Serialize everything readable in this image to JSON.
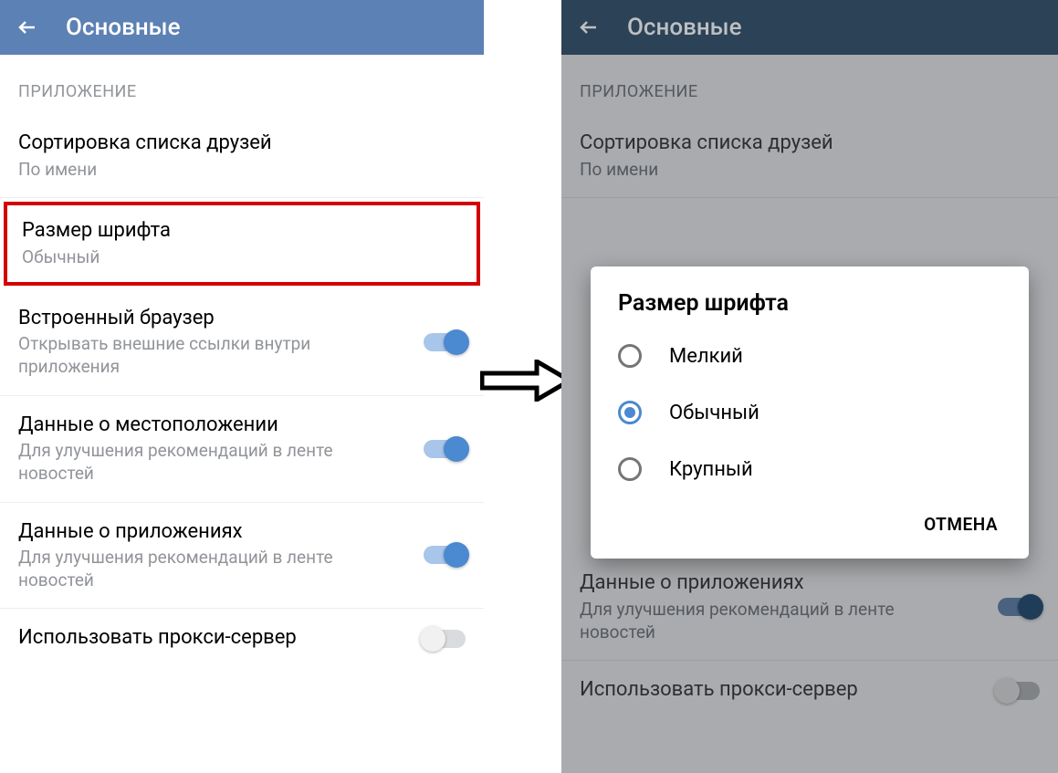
{
  "header": {
    "title": "Основные"
  },
  "section": "ПРИЛОЖЕНИЕ",
  "items": {
    "sort": {
      "title": "Сортировка списка друзей",
      "sub": "По имени"
    },
    "font": {
      "title": "Размер шрифта",
      "sub": "Обычный"
    },
    "browser": {
      "title": "Встроенный браузер",
      "sub": "Открывать внешние ссылки внутри приложения"
    },
    "location": {
      "title": "Данные о местоположении",
      "sub": "Для улучшения рекомендаций в ленте новостей"
    },
    "apps": {
      "title": "Данные о приложениях",
      "sub": "Для улучшения рекомендаций в ленте новостей"
    },
    "proxy": {
      "title": "Использовать прокси-сервер"
    }
  },
  "dialog": {
    "title": "Размер шрифта",
    "options": {
      "small": "Мелкий",
      "normal": "Обычный",
      "large": "Крупный"
    },
    "cancel": "ОТМЕНА"
  }
}
